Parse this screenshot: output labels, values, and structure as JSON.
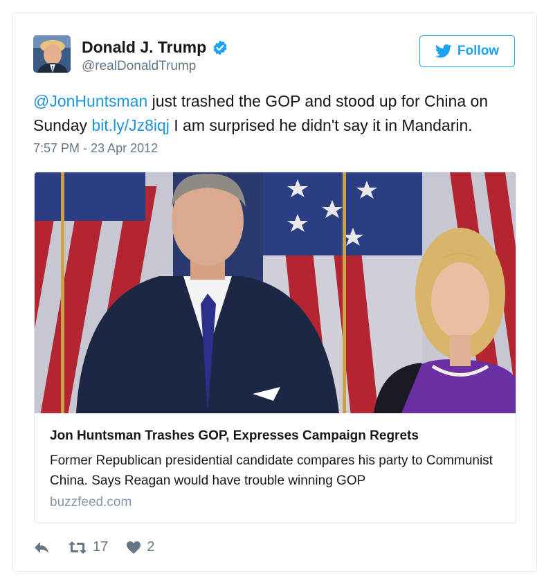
{
  "tweet": {
    "author_name": "Donald J. Trump",
    "author_handle": "@realDonaldTrump",
    "follow_label": "Follow",
    "text": {
      "mention": "@JonHuntsman",
      "part1": " just trashed the GOP and stood up for China on Sunday ",
      "link": "bit.ly/Jz8iqj",
      "part2": " I am surprised he didn't say it in Mandarin."
    },
    "timestamp": "7:57 PM - 23 Apr 2012"
  },
  "card": {
    "title": "Jon Huntsman Trashes GOP, Expresses Campaign Regrets",
    "description": "Former Republican presidential candidate compares his party to Communist China. Says Reagan would have trouble winning GOP",
    "domain": "buzzfeed.com"
  },
  "actions": {
    "reply_icon": "reply-icon",
    "retweet_icon": "retweet-icon",
    "retweet_count": "17",
    "like_icon": "heart-icon",
    "like_count": "2"
  },
  "colors": {
    "accent": "#1da1f2",
    "link": "#1b95e0",
    "secondary_text": "#657786",
    "border": "#e1e8ed"
  }
}
